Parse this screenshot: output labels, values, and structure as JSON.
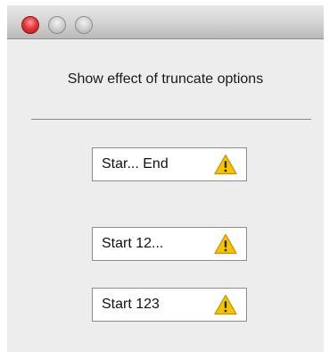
{
  "window": {
    "title": "",
    "heading": "Show effect of truncate options"
  },
  "buttons": [
    {
      "label": "Star... End",
      "icon": "warning-icon"
    },
    {
      "label": "Start 12...",
      "icon": "warning-icon"
    },
    {
      "label": "Start 123",
      "icon": "warning-icon"
    }
  ],
  "colors": {
    "close": "#e63a3a",
    "warning": "#f5c400"
  }
}
